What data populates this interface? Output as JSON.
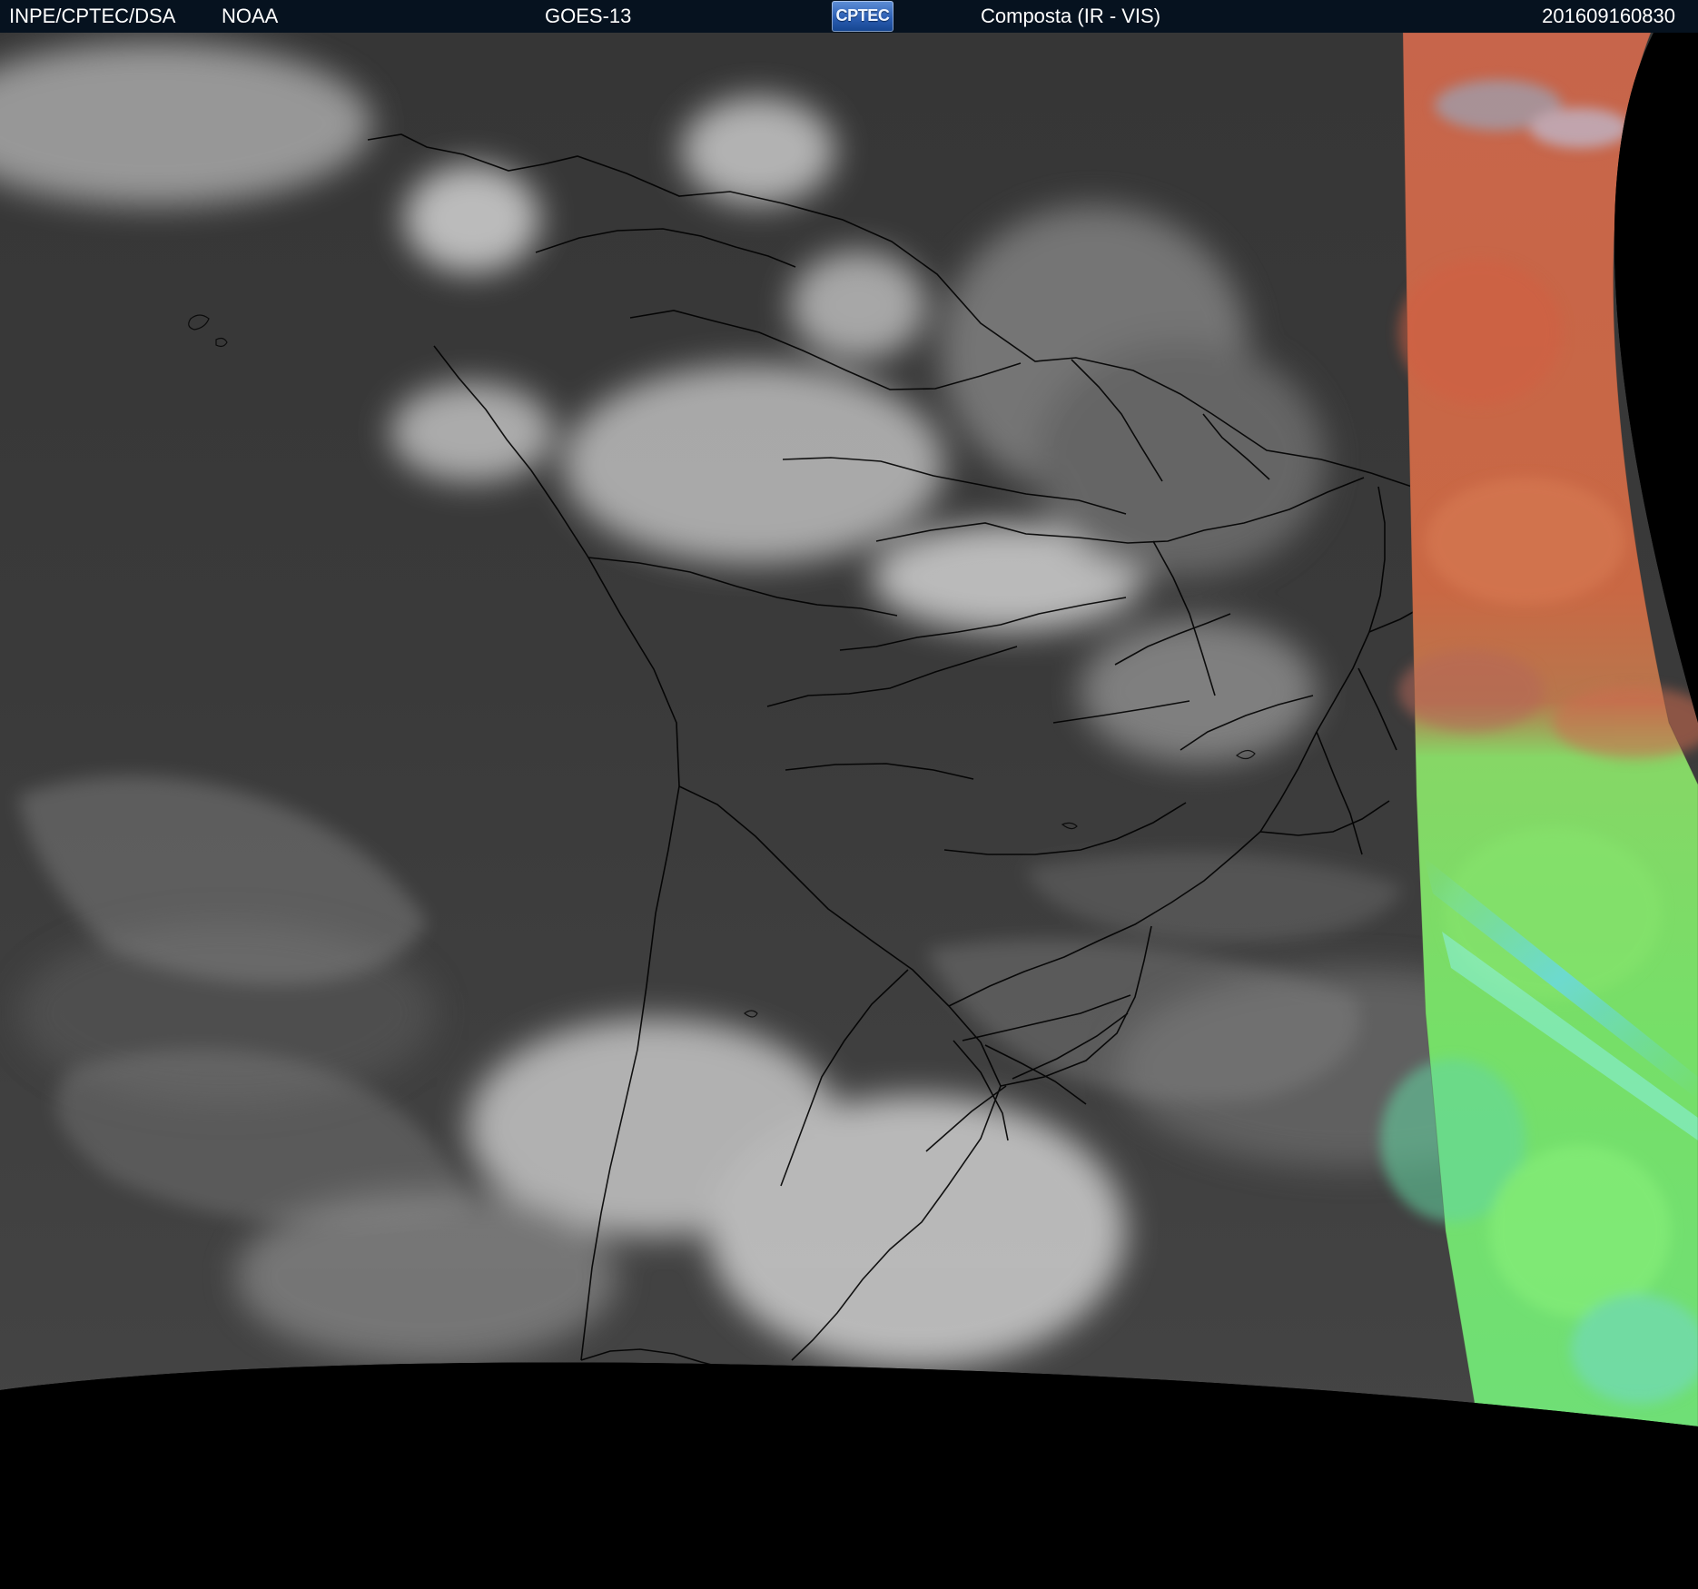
{
  "header": {
    "agency_primary": "INPE/CPTEC/DSA",
    "agency_secondary": "NOAA",
    "satellite": "GOES-13",
    "logo_text": "CPTEC",
    "product": "Composta (IR - VIS)",
    "timestamp": "201609160830"
  },
  "map": {
    "region": "South America",
    "projection": "geostationary full-disk segment",
    "channels": [
      "IR",
      "VIS"
    ],
    "colors": {
      "background": "#000000",
      "header_background": "#06121f",
      "ocean_ir": "#3b3b3b",
      "cloud_tops": "#d8d8d8",
      "borders": "#000000",
      "vis_orange": "#c96a45",
      "vis_green": "#7fe36c",
      "vis_cyan": "#68d8e6"
    }
  }
}
